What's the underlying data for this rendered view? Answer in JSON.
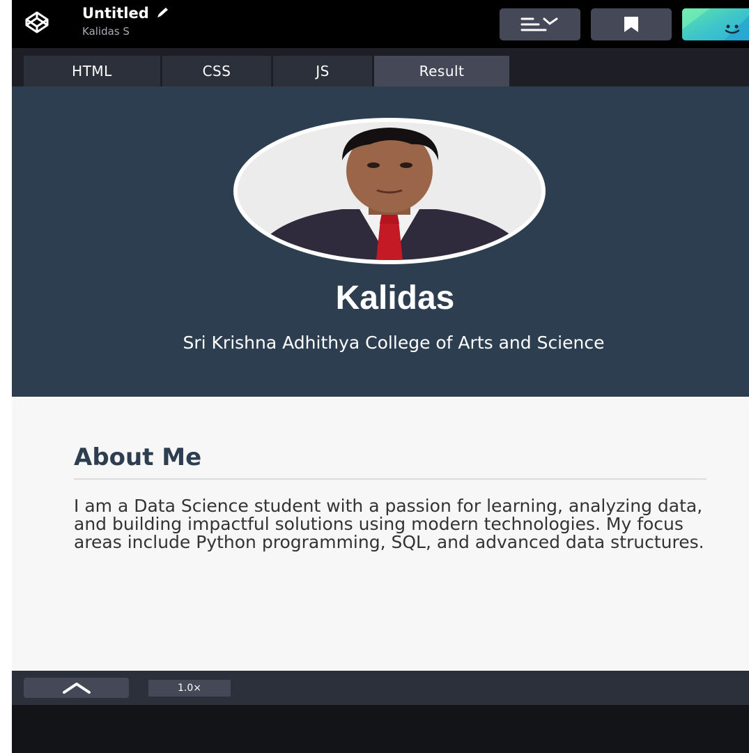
{
  "header": {
    "title": "Untitled",
    "author": "Kalidas S"
  },
  "tabs": [
    {
      "label": "HTML"
    },
    {
      "label": "CSS"
    },
    {
      "label": "JS"
    },
    {
      "label": "Result"
    }
  ],
  "profile": {
    "name": "Kalidas",
    "college": "Sri Krishna Adhithya College of Arts and Science"
  },
  "about": {
    "heading": "About Me",
    "body": "I am a Data Science student with a passion for learning, analyzing data, and building impactful solutions using modern technologies. My focus areas include Python programming, SQL, and advanced data structures."
  },
  "bottombar": {
    "zoom_label": "1.0×"
  },
  "colors": {
    "hero_bg": "#2c3e50",
    "header_bg": "#000000",
    "tab_active": "#444857",
    "tab_inactive": "#2c303a"
  }
}
